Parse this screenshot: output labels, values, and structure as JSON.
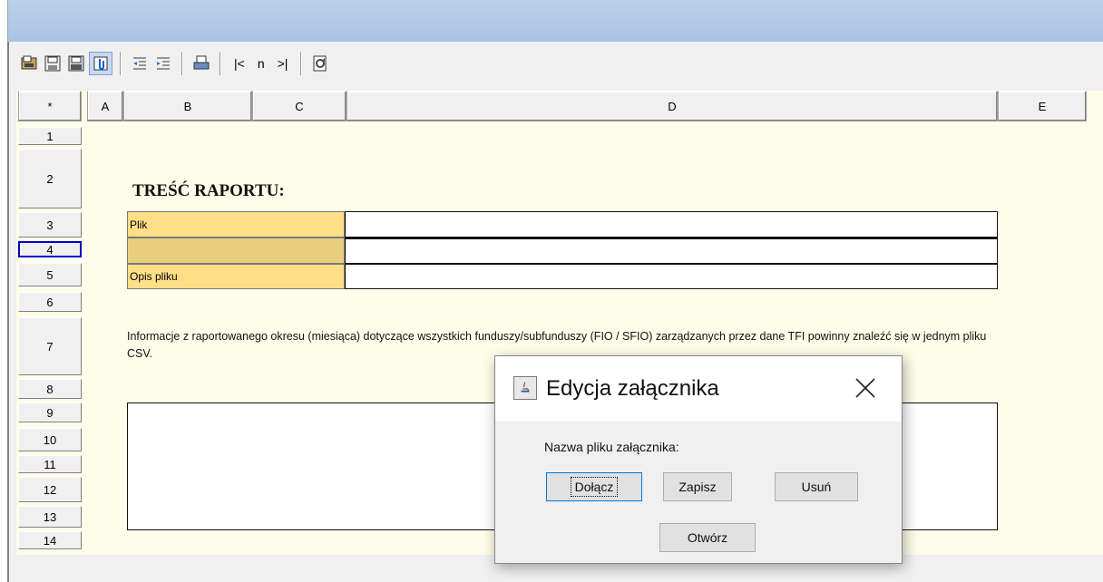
{
  "toolbar": {
    "buttons": [
      "open-icon",
      "save-icon",
      "save-as-icon",
      "attach-icon",
      "indent-left-icon",
      "indent-right-icon",
      "print-icon"
    ],
    "nav_first": "|<",
    "nav_n": "n",
    "nav_last": ">|",
    "refresh": "refresh-icon"
  },
  "grid": {
    "corner": "*",
    "columns": [
      "A",
      "B",
      "C",
      "D",
      "E"
    ],
    "rows": [
      "1",
      "2",
      "3",
      "4",
      "5",
      "6",
      "7",
      "8",
      "9",
      "10",
      "11",
      "12",
      "13",
      "14"
    ],
    "selected_row": "4"
  },
  "report": {
    "title": "TREŚĆ RAPORTU:",
    "file_label": "Plik",
    "description_label": "Opis pliku",
    "info_text": "Informacje z raportowanego okresu (miesiąca) dotyczące wszystkich funduszy/subfunduszy (FIO / SFIO) zarządzanych przez dane TFI powinny znaleźć się w jednym pliku CSV."
  },
  "dialog": {
    "title": "Edycja załącznika",
    "label": "Nazwa pliku załącznika:",
    "attach_button": "Dołącz",
    "save_button": "Zapisz",
    "delete_button": "Usuń",
    "open_button": "Otwórz"
  },
  "colors": {
    "sheet_bg": "#fefde9",
    "label_bg": "#fedf87",
    "title_bar": "#aac3e3"
  }
}
